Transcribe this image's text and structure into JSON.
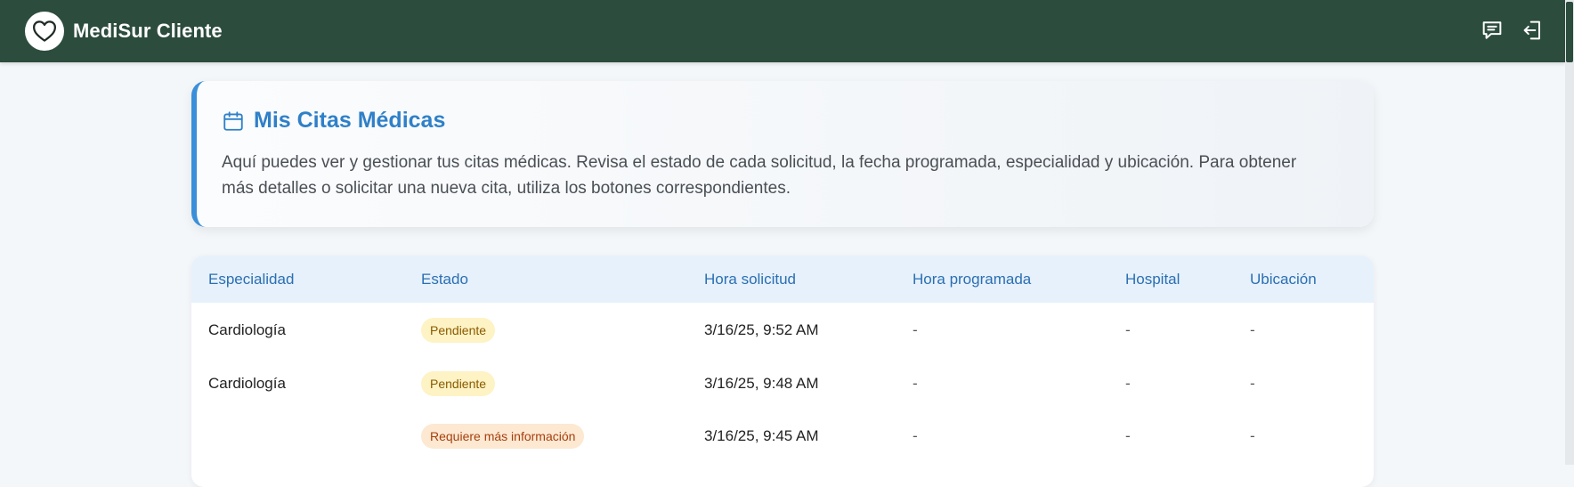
{
  "navbar": {
    "title": "MediSur Cliente",
    "logo_icon": "heart-icon",
    "actions": [
      {
        "name": "messages",
        "icon": "chat-icon"
      },
      {
        "name": "logout",
        "icon": "logout-icon"
      }
    ]
  },
  "colors": {
    "navbar": "#2c4c3d",
    "accent": "#2f80c8",
    "card_border": "#3a8fd9",
    "table_header_bg": "#e7f1fb",
    "badge_pending_bg": "#fdf3c4",
    "badge_info_bg": "#fde8d2"
  },
  "info_card": {
    "icon": "calendar-icon",
    "title": "Mis Citas Médicas",
    "description": "Aquí puedes ver y gestionar tus citas médicas. Revisa el estado de cada solicitud, la fecha programada, especialidad y ubicación. Para obtener más detalles o solicitar una nueva cita, utiliza los botones correspondientes."
  },
  "table": {
    "columns": [
      "Especialidad",
      "Estado",
      "Hora solicitud",
      "Hora programada",
      "Hospital",
      "Ubicación"
    ],
    "rows": [
      {
        "especialidad": "Cardiología",
        "estado": "Pendiente",
        "hora_solicitud": "3/16/25, 9:52 AM",
        "hora_programada": "-",
        "hospital": "-",
        "ubicacion": "-"
      },
      {
        "especialidad": "Cardiología",
        "estado": "Pendiente",
        "hora_solicitud": "3/16/25, 9:48 AM",
        "hora_programada": "-",
        "hospital": "-",
        "ubicacion": "-"
      },
      {
        "especialidad": "",
        "estado": "Requiere más información",
        "hora_solicitud": "3/16/25, 9:45 AM",
        "hora_programada": "-",
        "hospital": "-",
        "ubicacion": "-"
      }
    ]
  }
}
